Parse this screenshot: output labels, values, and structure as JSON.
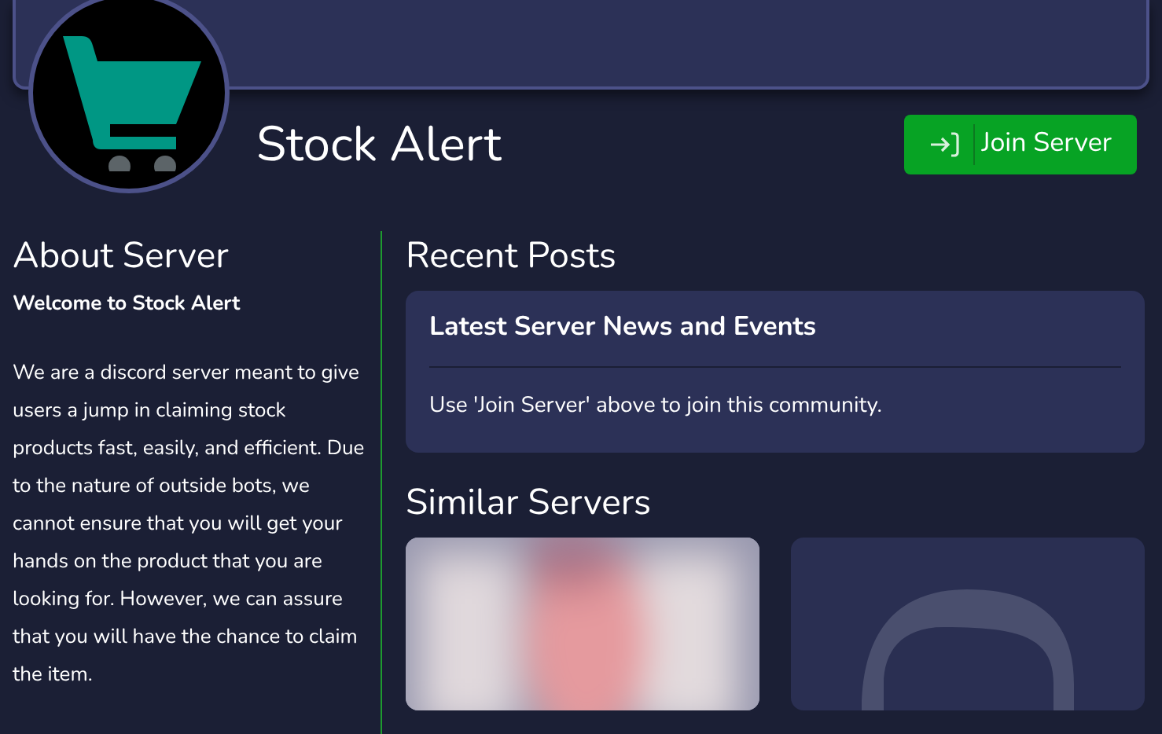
{
  "server": {
    "name": "Stock Alert",
    "join_button": "Join Server"
  },
  "about": {
    "heading": "About Server",
    "welcome": "Welcome to Stock Alert",
    "description": "We are a discord server meant to give users a jump in claiming stock products fast, easily, and efficient. Due to the nature of outside bots, we cannot ensure that you will get your hands on the product that you are looking for. However, we can assure that you will have the chance to claim the item."
  },
  "recent_posts": {
    "heading": "Recent Posts",
    "posts": [
      {
        "title": "Latest Server News and Events",
        "body": "Use 'Join Server' above to join this community."
      }
    ]
  },
  "similar_servers": {
    "heading": "Similar Servers",
    "items": [
      {
        "kind": "picture"
      },
      {
        "kind": "placeholder"
      }
    ]
  }
}
